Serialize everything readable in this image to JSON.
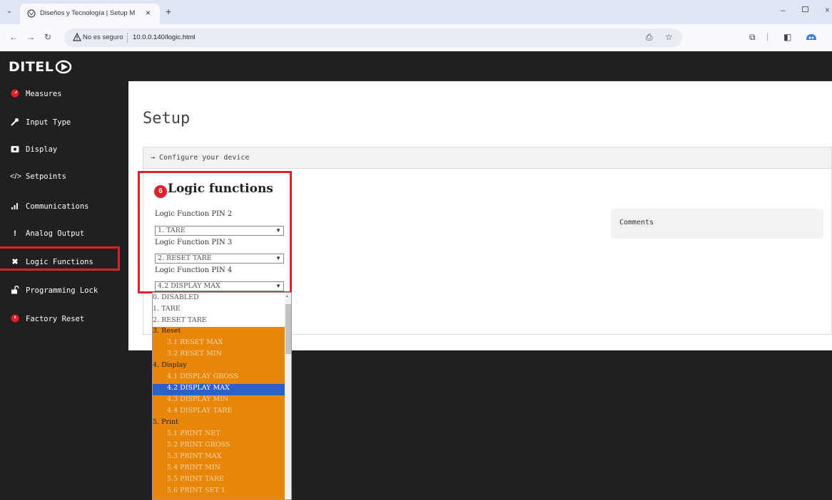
{
  "browser": {
    "tab_title": "Diseños y Tecnología | Setup M",
    "tab_close": "×",
    "new_tab": "+",
    "security_label": "No es seguro",
    "url": "10.0.0.140/logic.html",
    "minimize": "–",
    "close": "×"
  },
  "header": {
    "logo_text": "DITEL"
  },
  "sidebar": {
    "items": [
      {
        "label": "Measures",
        "icon": "speedometer-icon",
        "color": "#e0202a"
      },
      {
        "label": "Input Type",
        "icon": "wrench-icon"
      },
      {
        "label": "Display",
        "icon": "camera-icon"
      },
      {
        "label": "Setpoints",
        "icon": "code-icon"
      },
      {
        "label": "Communications",
        "icon": "signal-icon"
      },
      {
        "label": "Analog Output",
        "icon": "exclamation-icon"
      },
      {
        "label": "Logic Functions",
        "icon": "cross-icon"
      },
      {
        "label": "Programming Lock",
        "icon": "unlock-icon"
      },
      {
        "label": "Factory Reset",
        "icon": "power-icon",
        "color": "#e0202a"
      }
    ]
  },
  "main": {
    "title": "Setup",
    "card_header": "→ Configure your device",
    "step_number": "6",
    "section_title": "Logic functions",
    "pins": [
      {
        "label": "Logic Function PIN 2",
        "value": "1. TARE"
      },
      {
        "label": "Logic Function PIN 3",
        "value": "2. RESET TARE"
      },
      {
        "label": "Logic Function PIN 4",
        "value": "4.2 DISPLAY MAX"
      }
    ],
    "comments_label": "Comments"
  },
  "dropdown": {
    "options": [
      {
        "text": "0. DISABLED",
        "kind": "plain"
      },
      {
        "text": "1. TARE",
        "kind": "plain"
      },
      {
        "text": "2. RESET TARE",
        "kind": "plain"
      },
      {
        "text": "3. Reset",
        "kind": "group"
      },
      {
        "text": "3.1 RESET MAX",
        "kind": "sub"
      },
      {
        "text": "3.2 RESET MIN",
        "kind": "sub"
      },
      {
        "text": "4. Display",
        "kind": "group"
      },
      {
        "text": "4.1 DISPLAY GROSS",
        "kind": "sub"
      },
      {
        "text": "4.2 DISPLAY MAX",
        "kind": "selected"
      },
      {
        "text": "4.3 DISPLAY MIN",
        "kind": "sub"
      },
      {
        "text": "4.4 DISPLAY TARE",
        "kind": "sub"
      },
      {
        "text": "5. Print",
        "kind": "group"
      },
      {
        "text": "5.1 PRINT NET",
        "kind": "sub"
      },
      {
        "text": "5.2 PRINT GROSS",
        "kind": "sub"
      },
      {
        "text": "5.3 PRINT MAX",
        "kind": "sub"
      },
      {
        "text": "5.4 PRINT MIN",
        "kind": "sub"
      },
      {
        "text": "5.5 PRINT TARE",
        "kind": "sub"
      },
      {
        "text": "5.6 PRINT SET 1",
        "kind": "sub"
      }
    ]
  },
  "colors": {
    "accent_red": "#e0202a",
    "dark_bg": "#202020",
    "option_orange": "#e8860a",
    "option_selected": "#2b62c9"
  }
}
